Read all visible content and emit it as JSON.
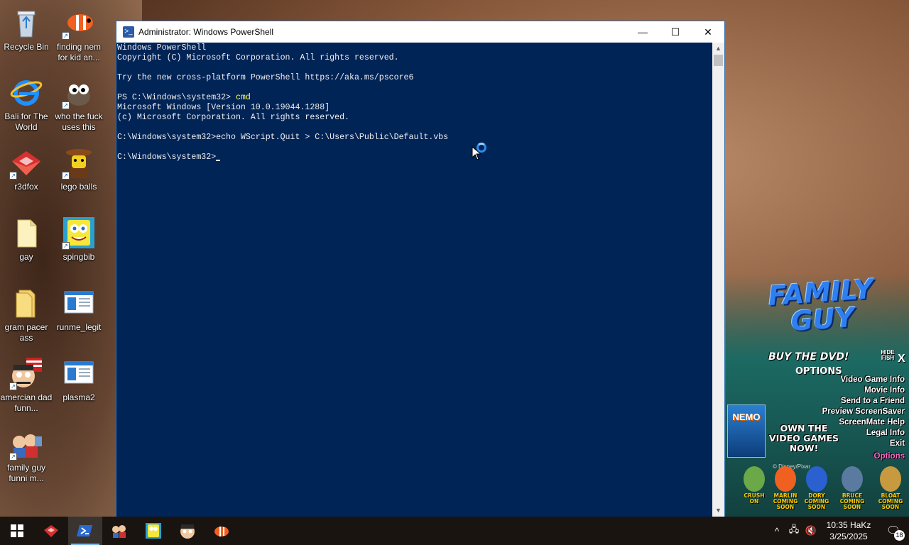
{
  "desktop": {
    "icons": [
      {
        "label": "Recycle Bin"
      },
      {
        "label": "finding nem for kid an..."
      },
      {
        "label": "Bali for The World"
      },
      {
        "label": "who the fuck uses this"
      },
      {
        "label": "r3dfox"
      },
      {
        "label": "lego balls"
      },
      {
        "label": "gay"
      },
      {
        "label": "spingbib"
      },
      {
        "label": "gram pacer ass"
      },
      {
        "label": "runme_legit"
      },
      {
        "label": "amercian dad funn..."
      },
      {
        "label": "plasma2"
      },
      {
        "label": "family guy funni m..."
      }
    ]
  },
  "powershell": {
    "title": "Administrator: Windows PowerShell",
    "lines": [
      "Windows PowerShell",
      "Copyright (C) Microsoft Corporation. All rights reserved.",
      "",
      "Try the new cross-platform PowerShell https://aka.ms/pscore6",
      "",
      "PS C:\\Windows\\system32> ",
      "Microsoft Windows [Version 10.0.19044.1288]",
      "(c) Microsoft Corporation. All rights reserved.",
      "",
      "C:\\Windows\\system32>echo WScript.Quit > C:\\Users\\Public\\Default.vbs",
      "",
      "C:\\Windows\\system32>"
    ],
    "typed_command": "cmd",
    "minimize": "—",
    "maximize": "☐",
    "close": "✕"
  },
  "screenmate": {
    "title": "FAMILY GUY",
    "buy": "BUY THE DVD!",
    "options_top": "OPTIONS",
    "hide_fish": "HIDE FISH",
    "close": "X",
    "menu": [
      "Video Game Info",
      "Movie Info",
      "Send to a Friend",
      "Preview ScreenSaver",
      "ScreenMate Help",
      "Legal Info",
      "Exit"
    ],
    "options": "Options",
    "nemo": "NEMO",
    "promo": "OWN THE VIDEO GAMES NOW!",
    "copyright": "© Disney/Pixar",
    "characters": [
      {
        "name": "CRUSH",
        "status": "ON"
      },
      {
        "name": "MARLIN",
        "status": "COMING SOON"
      },
      {
        "name": "DORY",
        "status": "COMING SOON"
      },
      {
        "name": "BRUCE",
        "status": "COMING SOON"
      },
      {
        "name": "BLOAT",
        "status": "COMING SOON"
      }
    ]
  },
  "taskbar": {
    "clock_time": "10:35 HaKz",
    "clock_date": "3/25/2025",
    "notification_count": "18"
  }
}
